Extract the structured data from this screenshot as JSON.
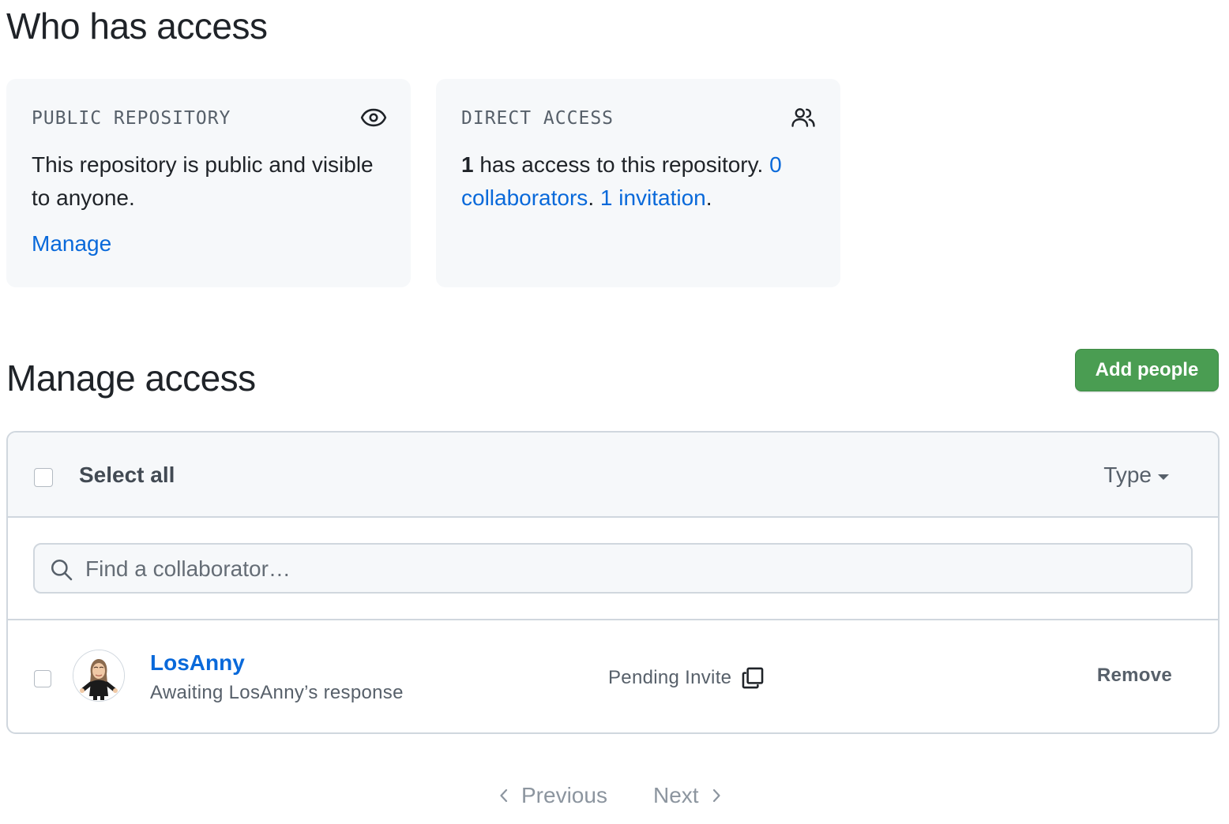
{
  "who_has_access": {
    "title": "Who has access",
    "public_card": {
      "label": "PUBLIC REPOSITORY",
      "icon": "eye-icon",
      "text": "This repository is public and visible to anyone.",
      "manage_link": "Manage"
    },
    "direct_card": {
      "label": "DIRECT ACCESS",
      "icon": "people-icon",
      "count": "1",
      "text": " has access to this repository. ",
      "collaborators_link": "0 collaborators",
      "period1": ". ",
      "invitations_link": "1 invitation",
      "period2": "."
    }
  },
  "manage_access": {
    "title": "Manage access",
    "add_button": "Add people",
    "table": {
      "select_all": "Select all",
      "type_filter": "Type",
      "search_placeholder": "Find a collaborator…",
      "rows": [
        {
          "name": "LosAnny",
          "status": "Awaiting LosAnny’s response",
          "role": "Pending Invite",
          "action": "Remove"
        }
      ]
    }
  },
  "pagination": {
    "previous": "Previous",
    "next": "Next"
  },
  "colors": {
    "link": "#0969da",
    "primary_button": "#4a9d52",
    "card_bg": "#f6f8fa",
    "border": "#d0d7de"
  }
}
